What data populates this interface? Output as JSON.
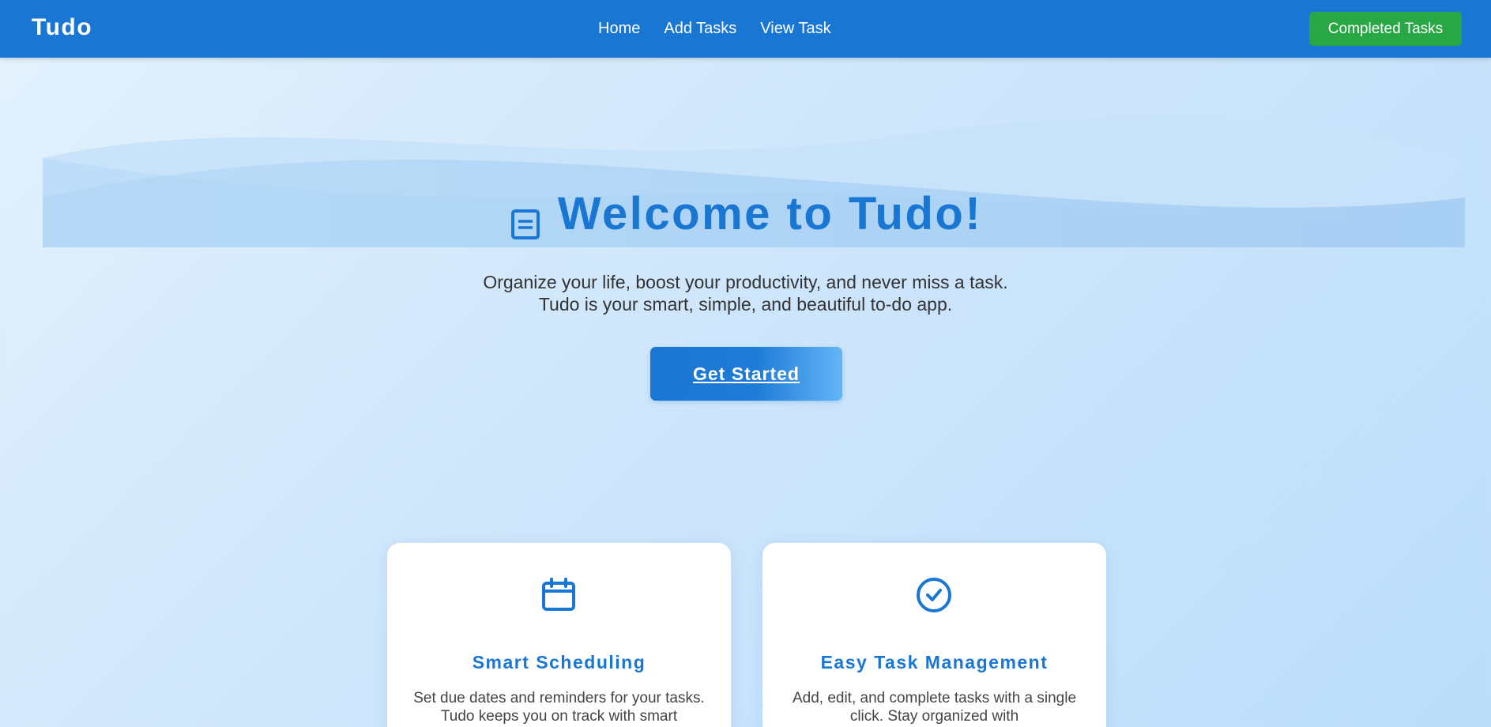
{
  "navbar": {
    "brand": "Tudo",
    "links": [
      "Home",
      "Add Tasks",
      "View Task"
    ],
    "completed_button": "Completed Tasks"
  },
  "hero": {
    "title": "Welcome to Tudo!",
    "title_icon": "notes-icon",
    "subtitle_line1": "Organize your life, boost your productivity, and never miss a task.",
    "subtitle_line2": "Tudo is your smart, simple, and beautiful to-do app.",
    "cta_label": "Get Started"
  },
  "features": [
    {
      "icon": "calendar-icon",
      "title": "Smart Scheduling",
      "text": "Set due dates and reminders for your tasks. Tudo keeps you on track with smart"
    },
    {
      "icon": "check-circle-icon",
      "title": "Easy Task Management",
      "text": "Add, edit, and complete tasks with a single click. Stay organized with"
    }
  ],
  "colors": {
    "primary": "#1976d2",
    "success": "#28a745",
    "background": "#e3f2fd"
  }
}
